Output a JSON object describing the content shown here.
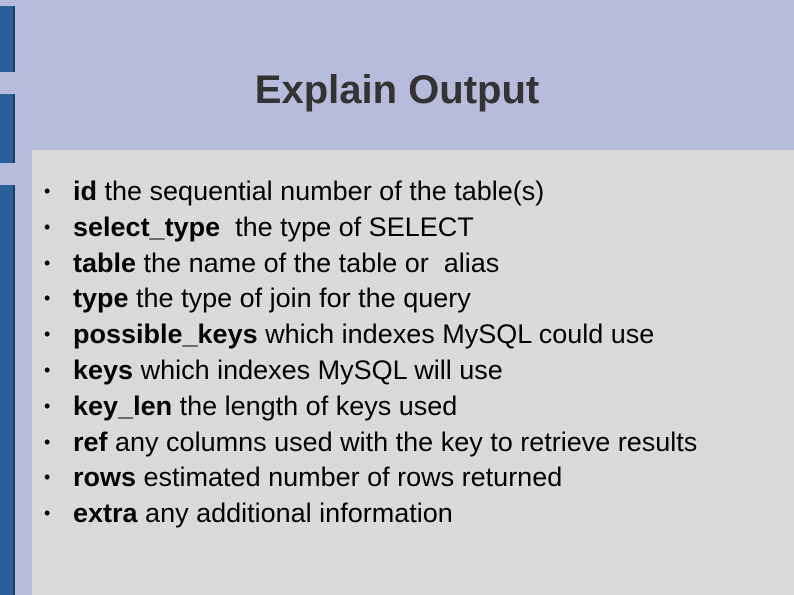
{
  "slide": {
    "title": "Explain Output",
    "bullet_symbol": "•",
    "items": [
      {
        "term": "id",
        "description": " the sequential number of the table(s)"
      },
      {
        "term": "select_type",
        "description": "  the type of SELECT"
      },
      {
        "term": "table",
        "description": " the name of the table or  alias"
      },
      {
        "term": "type",
        "description": " the type of join for the query"
      },
      {
        "term": "possible_keys",
        "description": " which indexes MySQL could use"
      },
      {
        "term": "keys",
        "description": " which indexes MySQL will use"
      },
      {
        "term": "key_len",
        "description": " the length of keys used"
      },
      {
        "term": "ref",
        "description": " any columns used with the key to retrieve results"
      },
      {
        "term": "rows",
        "description": " estimated number of rows returned"
      },
      {
        "term": "extra",
        "description": " any additional information"
      }
    ]
  },
  "colors": {
    "background": "#b8bcdc",
    "panel": "#dadada",
    "accent": "#2a5f9c",
    "title": "#333333"
  }
}
